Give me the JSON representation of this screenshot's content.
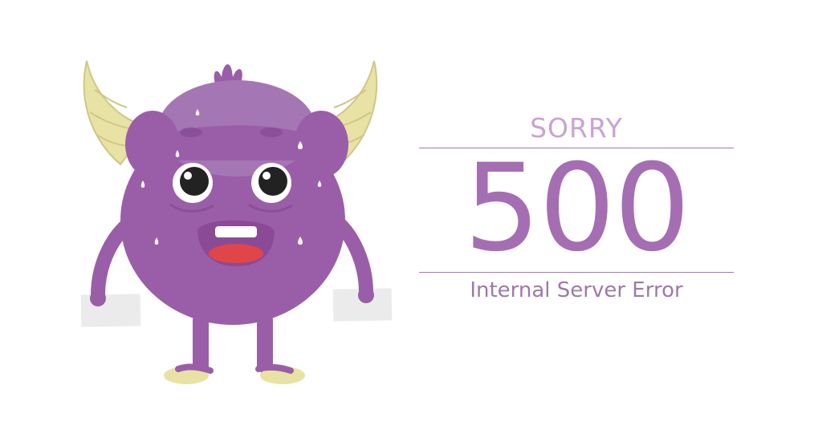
{
  "message": {
    "sorry": "SORRY",
    "code": "500",
    "description": "Internal Server Error"
  },
  "colors": {
    "body": "#9a5ea8",
    "body_highlight": "#a576b4",
    "horn": "#e8e2a4",
    "horn_stroke": "#cfc788",
    "mouth": "#8b4a95",
    "tongue": "#e04547",
    "sign": "#ecebec",
    "text_light": "#c9a3d3",
    "text_main": "#a56eb3"
  },
  "icons": {
    "illustration": "purple-monster-illustration"
  }
}
